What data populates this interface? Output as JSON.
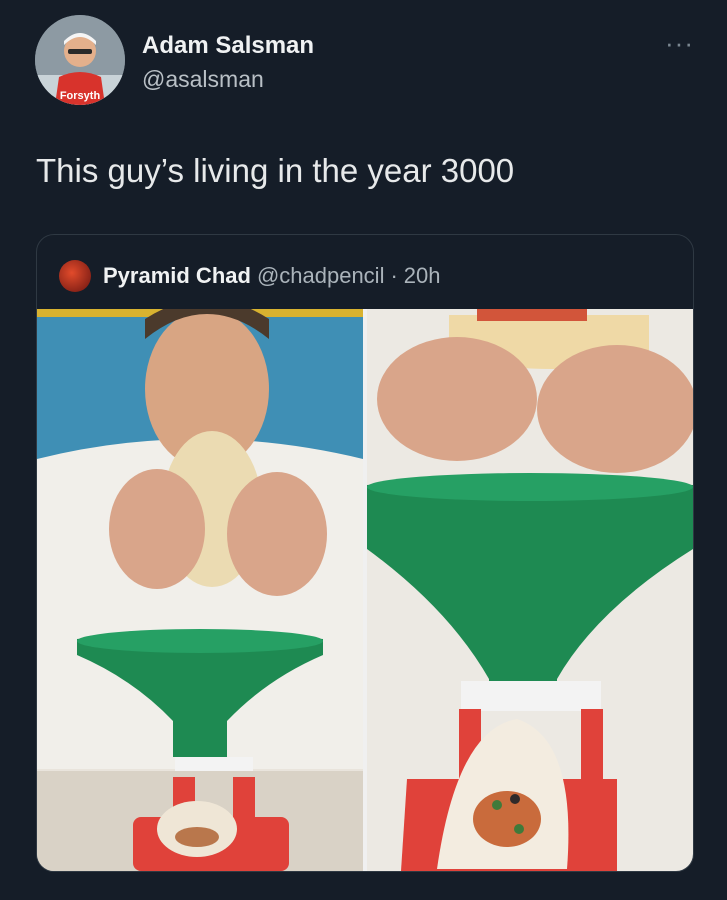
{
  "author": {
    "name": "Adam Salsman",
    "handle": "@asalsman",
    "avatar_icon": "user-avatar",
    "avatar_shirt_text": "Forsyth"
  },
  "tweet": {
    "text": "This guy’s living in the year 3000"
  },
  "more_icon": "more-options-icon",
  "quoted_tweet": {
    "avatar_icon": "user-avatar",
    "name": "Pyramid Chad",
    "handle": "@chadpencil",
    "separator": "·",
    "time": "20h"
  },
  "colors": {
    "background": "#151d28",
    "funnel_green": "#1e8a52",
    "holder_red": "#e0423a",
    "text_primary": "#e7e9ea",
    "text_secondary": "#aab3ba"
  }
}
